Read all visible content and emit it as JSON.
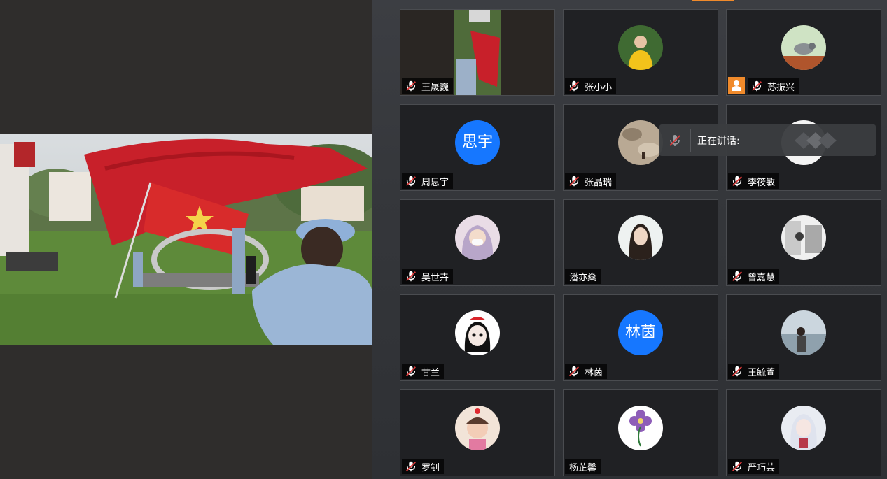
{
  "speaking": {
    "label": "正在讲话:"
  },
  "participants": [
    {
      "name": "王晟巍",
      "avatar": "video"
    },
    {
      "name": "张小小",
      "avatar": "photo-yellow"
    },
    {
      "name": "苏振兴",
      "avatar": "photo-bird",
      "sharing": true
    },
    {
      "name": "周思宇",
      "avatar": "text",
      "avatar_text": "思宇"
    },
    {
      "name": "张晶瑞",
      "avatar": "photo-stones"
    },
    {
      "name": "李筱敏",
      "avatar": "photo-white"
    },
    {
      "name": "吴世卉",
      "avatar": "photo-mask"
    },
    {
      "name": "潘亦燊",
      "avatar": "photo-girl",
      "no_mic": true
    },
    {
      "name": "曾嘉慧",
      "avatar": "photo-sketch"
    },
    {
      "name": "甘兰",
      "avatar": "photo-cartoon"
    },
    {
      "name": "林茵",
      "avatar": "text",
      "avatar_text": "林茵"
    },
    {
      "name": "王毓萱",
      "avatar": "photo-shore"
    },
    {
      "name": "罗钊",
      "avatar": "photo-baby"
    },
    {
      "name": "杨芷馨",
      "avatar": "photo-flower",
      "no_mic": true
    },
    {
      "name": "严巧芸",
      "avatar": "photo-anime"
    }
  ],
  "colors": {
    "accent": "#1677ff",
    "share": "#f08a2b",
    "flag": "#c8202a"
  },
  "icons": {
    "mic_muted": "mic-muted-icon",
    "share": "screen-share-icon"
  }
}
